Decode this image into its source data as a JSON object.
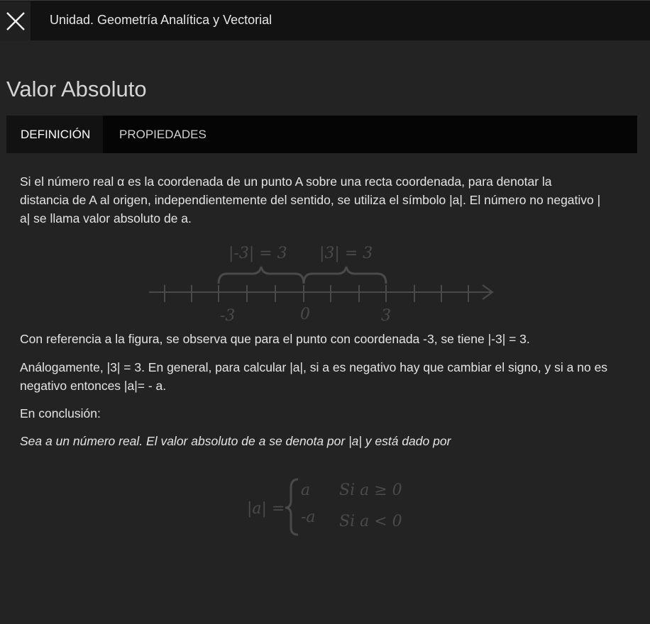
{
  "topbar": {
    "title": "Unidad. Geometría Analítica y Vectorial",
    "close_icon": "close-icon"
  },
  "page": {
    "title": "Valor Absoluto"
  },
  "tabs": [
    {
      "label": "DEFINICIÓN",
      "active": true
    },
    {
      "label": "PROPIEDADES",
      "active": false
    }
  ],
  "content": {
    "para1_line1": "Si el número real α es la coordenada de un punto A sobre una recta coordenada, para denotar la",
    "para1_line2": "distancia de A al origen, independientemente del sentido, se utiliza el símbolo |a|. El número no negativo |",
    "para1_line3": "a| se llama valor absoluto de a.",
    "para2": "Con referencia a la figura, se observa que para el punto con coordenada -3, se tiene |-3| = 3.",
    "para3_line1": "Análogamente, |3| = 3. En general, para calcular |a|, si a es negativo hay que cambiar el signo, y si a no es",
    "para3_line2": "negativo entonces |a|= - a.",
    "para4": "En conclusión:",
    "para5": "Sea a un número real. El valor absoluto de a se denota por |a| y está dado por"
  },
  "figure": {
    "label_left": "|-3| = 3",
    "label_right": "|3| = 3",
    "tick_neg3": "-3",
    "tick_0": "0",
    "tick_3": "3"
  },
  "formula": {
    "lhs": "|a| =",
    "case1_value": "a",
    "case1_condition": "Si a ≥ 0",
    "case2_value": "-a",
    "case2_condition": "Si a < 0"
  },
  "colors": {
    "background": "#232323",
    "topbar": "#121212",
    "tabs_bg": "#050505",
    "figure_ink": "#4a4a4a"
  }
}
